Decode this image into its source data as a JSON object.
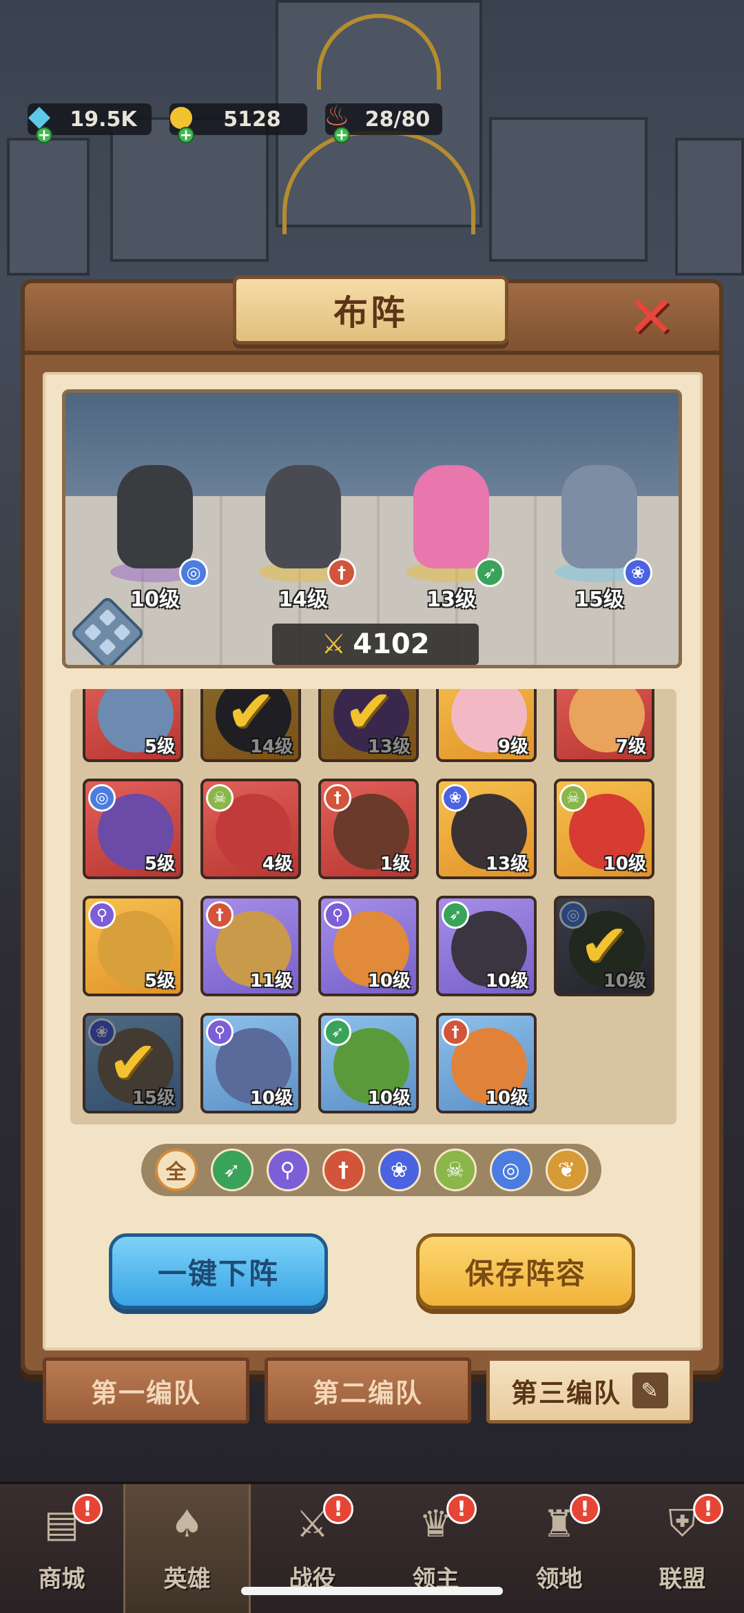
{
  "resources": [
    {
      "icon": "gem-icon",
      "value": "19.5K"
    },
    {
      "icon": "coin-icon",
      "value": "5128"
    },
    {
      "icon": "meat-icon",
      "value": "28/80"
    }
  ],
  "panel": {
    "title": "布阵",
    "close_icon": "close-icon"
  },
  "lineup": {
    "heroes": [
      {
        "level": "10级",
        "class_icon": "spiral-icon",
        "class_color": "#4b7ce0",
        "body_color": "#3a3d40"
      },
      {
        "level": "14级",
        "class_icon": "sword-icon",
        "class_color": "#d2543a",
        "body_color": "#4a4b52"
      },
      {
        "level": "13级",
        "class_icon": "bow-icon",
        "class_color": "#3aa35a",
        "body_color": "#e777ad"
      },
      {
        "level": "15级",
        "class_icon": "paw-icon",
        "class_color": "#4b63e0",
        "body_color": "#7d8da4"
      }
    ],
    "power": "4102"
  },
  "roster": [
    {
      "level": "5级",
      "rarity": "r-red",
      "class": "",
      "checked": false,
      "face": "#6d8ab0"
    },
    {
      "level": "14级",
      "rarity": "r-orange",
      "class": "",
      "checked": true,
      "face": "#3a3a40"
    },
    {
      "level": "13级",
      "rarity": "r-orange",
      "class": "",
      "checked": true,
      "face": "#6b4a8a"
    },
    {
      "level": "9级",
      "rarity": "r-orange",
      "class": "",
      "checked": false,
      "face": "#f2b9c4"
    },
    {
      "level": "7级",
      "rarity": "r-red",
      "class": "",
      "checked": false,
      "face": "#e9a35a"
    },
    {
      "level": "5级",
      "rarity": "r-red",
      "class": "spiral",
      "checked": false,
      "face": "#6b4aa8"
    },
    {
      "level": "4级",
      "rarity": "r-red",
      "class": "skull",
      "checked": false,
      "face": "#c23b3b"
    },
    {
      "level": "1级",
      "rarity": "r-red",
      "class": "sword",
      "checked": false,
      "face": "#6b3a2a"
    },
    {
      "level": "13级",
      "rarity": "r-orange",
      "class": "paw",
      "checked": false,
      "face": "#3a3234"
    },
    {
      "level": "10级",
      "rarity": "r-orange",
      "class": "skull",
      "checked": false,
      "face": "#d63c32"
    },
    {
      "level": "5级",
      "rarity": "r-orange",
      "class": "staff",
      "checked": false,
      "face": "#d8a03a"
    },
    {
      "level": "11级",
      "rarity": "r-purple",
      "class": "sword",
      "checked": false,
      "face": "#c99a4a"
    },
    {
      "level": "10级",
      "rarity": "r-purple",
      "class": "staff",
      "checked": false,
      "face": "#e08a3a"
    },
    {
      "level": "10级",
      "rarity": "r-purple",
      "class": "bow",
      "checked": false,
      "face": "#3a3540"
    },
    {
      "level": "10级",
      "rarity": "r-dark",
      "class": "spiral",
      "checked": true,
      "face": "#3d4a36"
    },
    {
      "level": "15级",
      "rarity": "r-blue",
      "class": "paw",
      "checked": true,
      "face": "#7a6a5a"
    },
    {
      "level": "10级",
      "rarity": "r-blue",
      "class": "staff",
      "checked": false,
      "face": "#5a6a9a"
    },
    {
      "level": "10级",
      "rarity": "r-blue",
      "class": "bow",
      "checked": false,
      "face": "#5a9a3a"
    },
    {
      "level": "10级",
      "rarity": "r-blue",
      "class": "sword",
      "checked": false,
      "face": "#e0823a"
    }
  ],
  "filters": [
    {
      "name": "filter-all",
      "label": "全",
      "cls": "all"
    },
    {
      "name": "filter-bow-icon",
      "label": "➶",
      "cls": "c-bow"
    },
    {
      "name": "filter-staff-icon",
      "label": "⚲",
      "cls": "c-staff"
    },
    {
      "name": "filter-sword-icon",
      "label": "†",
      "cls": "c-sword"
    },
    {
      "name": "filter-paw-icon",
      "label": "❀",
      "cls": "c-paw"
    },
    {
      "name": "filter-skull-icon",
      "label": "☠",
      "cls": "c-skull"
    },
    {
      "name": "filter-spiral-icon",
      "label": "◎",
      "cls": "c-spiral"
    },
    {
      "name": "filter-wing-icon",
      "label": "❦",
      "cls": "c-wing"
    }
  ],
  "buttons": {
    "unequip_all": "一键下阵",
    "save_lineup": "保存阵容"
  },
  "squads": [
    "第一编队",
    "第二编队",
    "第三编队"
  ],
  "nav": [
    {
      "label": "商城",
      "icon": "shop-icon",
      "glyph": "▤",
      "alert": true,
      "active": false
    },
    {
      "label": "英雄",
      "icon": "hero-cards-icon",
      "glyph": "♠",
      "alert": false,
      "active": true
    },
    {
      "label": "战役",
      "icon": "battle-swords-icon",
      "glyph": "⚔",
      "alert": true,
      "active": false
    },
    {
      "label": "领主",
      "icon": "lord-crown-icon",
      "glyph": "♛",
      "alert": true,
      "active": false
    },
    {
      "label": "领地",
      "icon": "territory-castle-icon",
      "glyph": "♜",
      "alert": true,
      "active": false
    },
    {
      "label": "联盟",
      "icon": "alliance-knight-icon",
      "glyph": "⛨",
      "alert": true,
      "active": false
    }
  ],
  "alert_glyph": "!"
}
